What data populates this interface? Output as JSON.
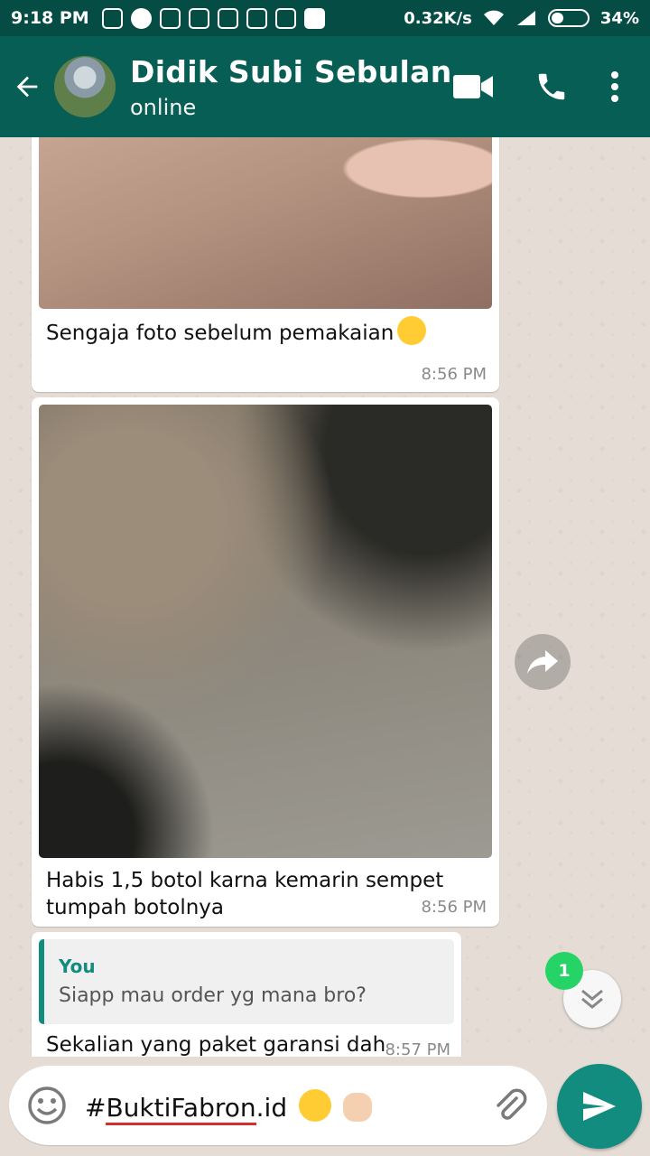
{
  "status_bar": {
    "time": "9:18 PM",
    "network_speed": "0.32K/s",
    "battery": "34%",
    "battery_level": 0.34
  },
  "header": {
    "contact_name": "Didik Subi Sebulan",
    "contact_status": "online",
    "icons": [
      "back-arrow-icon",
      "video-call-icon",
      "phone-icon",
      "more-vert-icon"
    ]
  },
  "messages": [
    {
      "type": "image",
      "caption": "Sengaja foto sebelum pemakaian",
      "emoji": "laughing-tears",
      "time": "8:56 PM"
    },
    {
      "type": "image",
      "caption_line1": "Habis 1,5 botol karna kemarin sempet",
      "caption_line2": "tumpah botolnya",
      "time": "8:56 PM"
    },
    {
      "type": "reply",
      "quote_author": "You",
      "quote_text": "Siapp mau order yg mana bro?",
      "text": "Sekalian yang paket garansi dah",
      "time": "8:57 PM"
    }
  ],
  "scroll_badge": "1",
  "composer": {
    "text_prefix": "#",
    "text_underlined": "BuktiFabron",
    "text_suffix": ".id",
    "emojis": [
      "sunglasses-face",
      "ok-hand"
    ]
  },
  "colors": {
    "header": "#075e54",
    "status_bar": "#054d44",
    "accent": "#128c7e",
    "badge": "#25d366"
  }
}
